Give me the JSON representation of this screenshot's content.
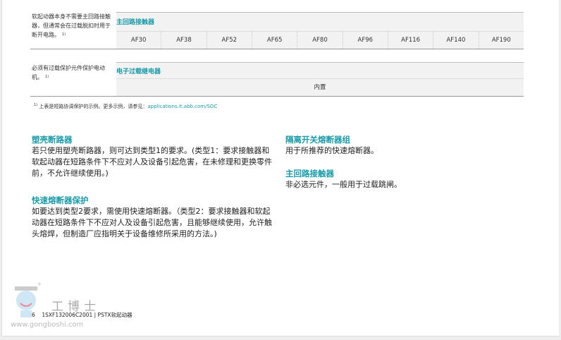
{
  "table1": {
    "note": "软起动器本身不需要主回路接触器，但通常会在过载脱扣时用于断开电路。",
    "note_sup": "1)",
    "header": "主回路接触器",
    "cells": [
      "AF30",
      "AF38",
      "AF52",
      "AF65",
      "AF80",
      "AF96",
      "AF116",
      "AF140",
      "AF190"
    ]
  },
  "table2": {
    "note": "必须有过载保护元件保护电动机。",
    "note_sup": "1)",
    "header": "电子过载继电器",
    "cell": "内置"
  },
  "footnote": {
    "sup": "1)",
    "text": "上表是短路协调保护的示例。更多示例，请参见：",
    "link": "applications.it.abb.com/SOC"
  },
  "sections": {
    "mccb": {
      "title": "塑壳断路器",
      "body": "若只使用塑壳断路器，则可达到类型1的要求。(类型1：要求接触器和软起动器在短路条件下不应对人及设备引起危害，在未修理和更换零件前，不允许继续使用。)"
    },
    "fuse": {
      "title": "快速熔断器保护",
      "body": "如要达到类型2要求，需使用快速熔断器。（类型2：要求接触器和软起动器在短路条件下不应对人及设备引起危害，且能够继续使用，允许触头熔焊，但制造厂应指明关于设备维修所采用的方法。)"
    },
    "switch_fuse": {
      "title": "隔离开关熔断器组",
      "body": "用于所推荐的快速熔断器。"
    },
    "contactor": {
      "title": "主回路接触器",
      "body": "非必选元件，一般用于过载跳闸。"
    }
  },
  "footer": {
    "page": "6",
    "doc": "1SXF132006C2001 | PSTX软起动器"
  },
  "watermark": {
    "brand": "工博士",
    "registered": "®",
    "url": "www.gongboshi.com"
  },
  "colors": {
    "accent": "#1a9aa8"
  }
}
